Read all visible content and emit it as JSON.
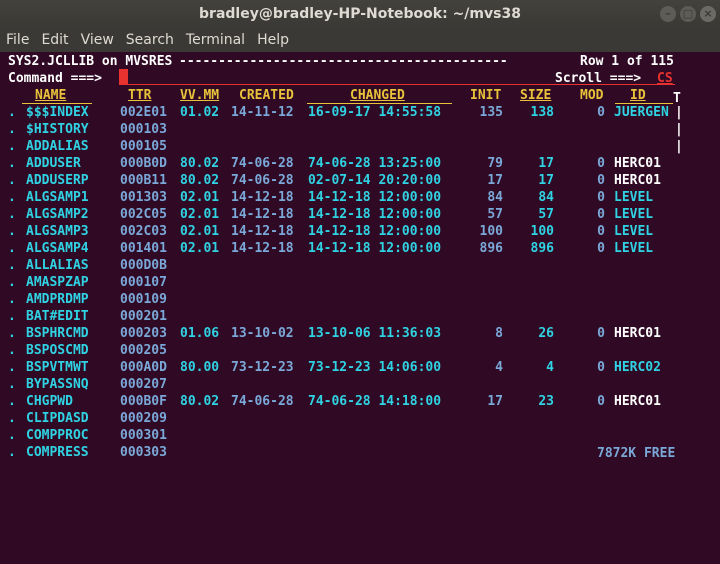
{
  "window": {
    "title": "bradley@bradley-HP-Notebook: ~/mvs38"
  },
  "menu": [
    "File",
    "Edit",
    "View",
    "Search",
    "Terminal",
    "Help"
  ],
  "header": {
    "dataset": "SYS2.JCLLIB on MVSRES",
    "dashes": "------------------------------------------",
    "row_label": "Row 1 of 115",
    "command_label": "Command ===>",
    "scroll_label": "Scroll ===>",
    "scroll_value": "CS"
  },
  "columns": {
    "name": "NAME",
    "ttr": "TTR",
    "vvmm": "VV.MM",
    "created": "CREATED",
    "changed": "CHANGED",
    "init": "INIT",
    "size": "SIZE",
    "mod": "MOD",
    "id": "ID"
  },
  "members": [
    {
      "sel": ".",
      "name": "$$$INDEX",
      "ttr": "002E01",
      "vvmm": "01.02",
      "created": "14-11-12",
      "changed": "16-09-17 14:55:58",
      "init": "135",
      "size": "138",
      "mod": "0",
      "id": "JUERGEN"
    },
    {
      "sel": ".",
      "name": "$HISTORY",
      "ttr": "000103",
      "vvmm": "",
      "created": "",
      "changed": "",
      "init": "",
      "size": "",
      "mod": "",
      "id": ""
    },
    {
      "sel": ".",
      "name": "ADDALIAS",
      "ttr": "000105",
      "vvmm": "",
      "created": "",
      "changed": "",
      "init": "",
      "size": "",
      "mod": "",
      "id": ""
    },
    {
      "sel": ".",
      "name": "ADDUSER",
      "ttr": "000B0D",
      "vvmm": "80.02",
      "created": "74-06-28",
      "changed": "74-06-28 13:25:00",
      "init": "79",
      "size": "17",
      "mod": "0",
      "id": "HERC01"
    },
    {
      "sel": ".",
      "name": "ADDUSERP",
      "ttr": "000B11",
      "vvmm": "80.02",
      "created": "74-06-28",
      "changed": "02-07-14 20:20:00",
      "init": "17",
      "size": "17",
      "mod": "0",
      "id": "HERC01"
    },
    {
      "sel": ".",
      "name": "ALGSAMP1",
      "ttr": "001303",
      "vvmm": "02.01",
      "created": "14-12-18",
      "changed": "14-12-18 12:00:00",
      "init": "84",
      "size": "84",
      "mod": "0",
      "id": "LEVEL"
    },
    {
      "sel": ".",
      "name": "ALGSAMP2",
      "ttr": "002C05",
      "vvmm": "02.01",
      "created": "14-12-18",
      "changed": "14-12-18 12:00:00",
      "init": "57",
      "size": "57",
      "mod": "0",
      "id": "LEVEL"
    },
    {
      "sel": ".",
      "name": "ALGSAMP3",
      "ttr": "002C03",
      "vvmm": "02.01",
      "created": "14-12-18",
      "changed": "14-12-18 12:00:00",
      "init": "100",
      "size": "100",
      "mod": "0",
      "id": "LEVEL"
    },
    {
      "sel": ".",
      "name": "ALGSAMP4",
      "ttr": "001401",
      "vvmm": "02.01",
      "created": "14-12-18",
      "changed": "14-12-18 12:00:00",
      "init": "896",
      "size": "896",
      "mod": "0",
      "id": "LEVEL"
    },
    {
      "sel": ".",
      "name": "ALLALIAS",
      "ttr": "000D0B",
      "vvmm": "",
      "created": "",
      "changed": "",
      "init": "",
      "size": "",
      "mod": "",
      "id": ""
    },
    {
      "sel": ".",
      "name": "AMASPZAP",
      "ttr": "000107",
      "vvmm": "",
      "created": "",
      "changed": "",
      "init": "",
      "size": "",
      "mod": "",
      "id": ""
    },
    {
      "sel": ".",
      "name": "AMDPRDMP",
      "ttr": "000109",
      "vvmm": "",
      "created": "",
      "changed": "",
      "init": "",
      "size": "",
      "mod": "",
      "id": ""
    },
    {
      "sel": ".",
      "name": "BAT#EDIT",
      "ttr": "000201",
      "vvmm": "",
      "created": "",
      "changed": "",
      "init": "",
      "size": "",
      "mod": "",
      "id": ""
    },
    {
      "sel": ".",
      "name": "BSPHRCMD",
      "ttr": "000203",
      "vvmm": "01.06",
      "created": "13-10-02",
      "changed": "13-10-06 11:36:03",
      "init": "8",
      "size": "26",
      "mod": "0",
      "id": "HERC01"
    },
    {
      "sel": ".",
      "name": "BSPOSCMD",
      "ttr": "000205",
      "vvmm": "",
      "created": "",
      "changed": "",
      "init": "",
      "size": "",
      "mod": "",
      "id": ""
    },
    {
      "sel": ".",
      "name": "BSPVTMWT",
      "ttr": "000A0D",
      "vvmm": "80.00",
      "created": "73-12-23",
      "changed": "73-12-23 14:06:00",
      "init": "4",
      "size": "4",
      "mod": "0",
      "id": "HERC02"
    },
    {
      "sel": ".",
      "name": "BYPASSNQ",
      "ttr": "000207",
      "vvmm": "",
      "created": "",
      "changed": "",
      "init": "",
      "size": "",
      "mod": "",
      "id": ""
    },
    {
      "sel": ".",
      "name": "CHGPWD",
      "ttr": "000B0F",
      "vvmm": "80.02",
      "created": "74-06-28",
      "changed": "74-06-28 14:18:00",
      "init": "17",
      "size": "23",
      "mod": "0",
      "id": "HERC01"
    },
    {
      "sel": ".",
      "name": "CLIPDASD",
      "ttr": "000209",
      "vvmm": "",
      "created": "",
      "changed": "",
      "init": "",
      "size": "",
      "mod": "",
      "id": ""
    },
    {
      "sel": ".",
      "name": "COMPPROC",
      "ttr": "000301",
      "vvmm": "",
      "created": "",
      "changed": "",
      "init": "",
      "size": "",
      "mod": "",
      "id": ""
    },
    {
      "sel": ".",
      "name": "COMPRESS",
      "ttr": "000303",
      "vvmm": "",
      "created": "",
      "changed": "",
      "init": "",
      "size": "",
      "mod": "",
      "id": ""
    }
  ],
  "id_colors": {
    "JUERGEN": "#2fd3e3",
    "HERC01": "#ffffff",
    "HERC02": "#2fd3e3",
    "LEVEL": "#2fd3e3"
  },
  "free_space": "7872K FREE",
  "scrollbar_marks": [
    "T",
    "|",
    "|",
    "|"
  ]
}
